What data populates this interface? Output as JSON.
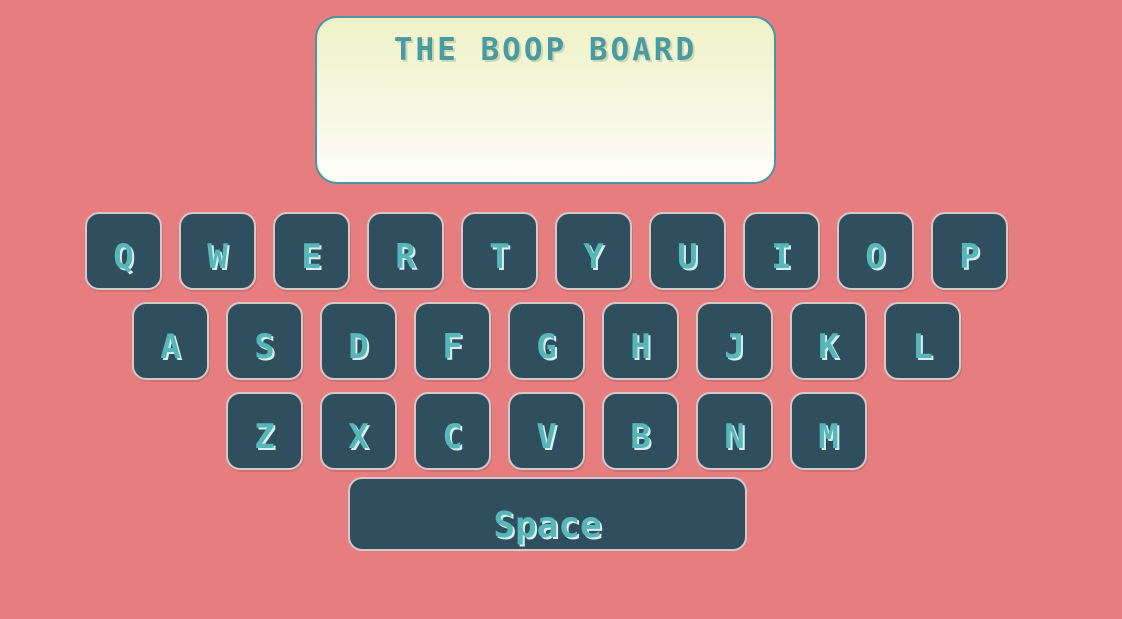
{
  "display": {
    "title": "THE BOOP BOARD",
    "text": ""
  },
  "keyboard": {
    "rows": [
      [
        "Q",
        "W",
        "E",
        "R",
        "T",
        "Y",
        "U",
        "I",
        "O",
        "P"
      ],
      [
        "A",
        "S",
        "D",
        "F",
        "G",
        "H",
        "J",
        "K",
        "L"
      ],
      [
        "Z",
        "X",
        "C",
        "V",
        "B",
        "N",
        "M"
      ]
    ],
    "space_label": "Space"
  },
  "colors": {
    "background": "#e67e80",
    "key_fill": "#2f4f5f",
    "key_text": "#56b6b8",
    "display_border": "#4a95a0"
  }
}
